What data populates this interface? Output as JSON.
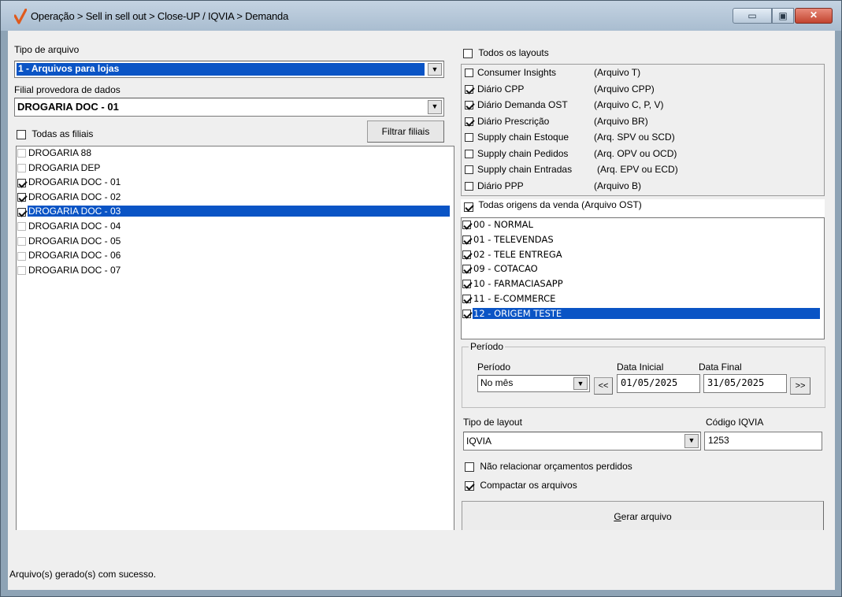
{
  "window": {
    "title": "Operação > Sell in sell out > Close-UP / IQVIA > Demanda",
    "min_glyph": "▭",
    "max_glyph": "▣",
    "close_glyph": "✕"
  },
  "tipo_arquivo": {
    "label": "Tipo de arquivo",
    "value": "1 - Arquivos para lojas"
  },
  "filial_provedora": {
    "label": "Filial provedora de dados",
    "value": "DROGARIA DOC - 01"
  },
  "todas_filiais": {
    "label": "Todas as filiais",
    "checked": false
  },
  "filtrar_filiais": "Filtrar filiais",
  "filiais": [
    {
      "label": "DROGARIA 88",
      "checked": false,
      "selected": false
    },
    {
      "label": "DROGARIA DEP",
      "checked": false,
      "selected": false
    },
    {
      "label": "DROGARIA DOC - 01",
      "checked": true,
      "selected": false
    },
    {
      "label": "DROGARIA DOC - 02",
      "checked": true,
      "selected": false
    },
    {
      "label": "DROGARIA DOC - 03",
      "checked": true,
      "selected": true
    },
    {
      "label": "DROGARIA DOC - 04",
      "checked": false,
      "selected": false
    },
    {
      "label": "DROGARIA DOC - 05",
      "checked": false,
      "selected": false
    },
    {
      "label": "DROGARIA DOC - 06",
      "checked": false,
      "selected": false
    },
    {
      "label": "DROGARIA DOC - 07",
      "checked": false,
      "selected": false
    }
  ],
  "todos_layouts": {
    "label": "Todos os layouts",
    "checked": false
  },
  "layouts": [
    {
      "name": "Consumer Insights",
      "file": "(Arquivo T)",
      "checked": false
    },
    {
      "name": "Diário CPP",
      "file": "(Arquivo CPP)",
      "checked": true
    },
    {
      "name": "Diário Demanda OST",
      "file": "(Arquivo C, P, V)",
      "checked": true
    },
    {
      "name": "Diário Prescrição",
      "file": "(Arquivo BR)",
      "checked": true
    },
    {
      "name": "Supply chain Estoque",
      "file": "(Arq. SPV ou SCD)",
      "checked": false
    },
    {
      "name": "Supply chain Pedidos",
      "file": "(Arq. OPV ou OCD)",
      "checked": false
    },
    {
      "name": " Supply chain Entradas",
      "file": "(Arq. EPV ou ECD)",
      "checked": false
    },
    {
      "name": "Diário PPP",
      "file": "(Arquivo B)",
      "checked": false
    }
  ],
  "todas_origens": {
    "label": "Todas origens da venda (Arquivo OST)",
    "checked": true
  },
  "origens": [
    {
      "label": "00 - NORMAL",
      "checked": true,
      "selected": false
    },
    {
      "label": "01 - TELEVENDAS",
      "checked": true,
      "selected": false
    },
    {
      "label": "02 - TELE ENTREGA",
      "checked": true,
      "selected": false
    },
    {
      "label": "09 - COTACAO",
      "checked": true,
      "selected": false
    },
    {
      "label": "10 - FARMACIASAPP",
      "checked": true,
      "selected": false
    },
    {
      "label": "11 - E-COMMERCE",
      "checked": true,
      "selected": false
    },
    {
      "label": "12 - ORIGEM TESTE",
      "checked": true,
      "selected": true
    }
  ],
  "periodo": {
    "group_label": "Período",
    "label": "Período",
    "value": "No mês",
    "prev": "<<",
    "next": ">>",
    "data_inicial_label": "Data Inicial",
    "data_inicial": "01/05/2025",
    "data_final_label": "Data Final",
    "data_final": "31/05/2025"
  },
  "tipo_layout": {
    "label": "Tipo de layout",
    "value": "IQVIA"
  },
  "codigo_iqvia": {
    "label": "Código IQVIA",
    "value": "1253"
  },
  "nao_relacionar": {
    "label": "Não relacionar orçamentos perdidos",
    "checked": false
  },
  "compactar": {
    "label": "Compactar os arquivos",
    "checked": true
  },
  "gerar_arquivo": "Gerar arquivo",
  "status": "Arquivo(s) gerado(s) com sucesso."
}
